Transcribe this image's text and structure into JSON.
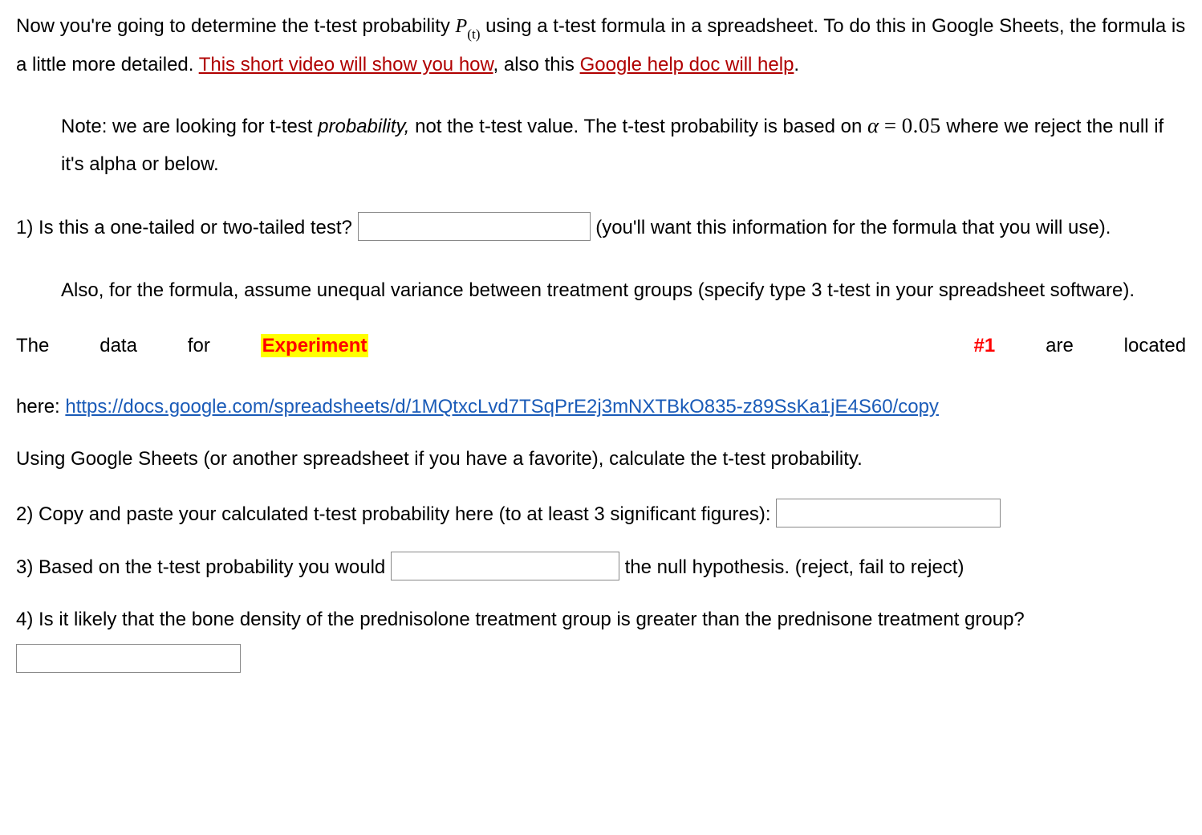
{
  "intro": {
    "part1": "Now you're going to determine the t-test probability ",
    "pt_P": "P",
    "pt_sub": "(t)",
    "part2": " using a t-test formula in a spreadsheet. To do this in Google Sheets, the formula is a little more detailed. ",
    "link1": "This short video will show  you how",
    "part3": ", also this ",
    "link2": "Google help doc will help",
    "part4": "."
  },
  "note": {
    "part1": "Note: we are looking for t-test ",
    "italic": "probability,",
    "part2": " not the t-test value. The t-test probability is based on ",
    "alpha": "α",
    "eq": " = ",
    "val": "0.05",
    "part3": " where we reject the null if it's alpha or below."
  },
  "q1": {
    "label": "1) Is this a one-tailed or two-tailed test? ",
    "after": " (you'll want this information for the formula that you will use)."
  },
  "also": "Also, for the formula, assume unequal variance between treatment groups (specify type 3 t-test in your spreadsheet software).",
  "dataline": {
    "the": "The",
    "data": "data",
    "for_": "for",
    "exp": "Experiment",
    "num": "#1",
    "are": "are",
    "located": "located",
    "here": "here: ",
    "url": "https://docs.google.com/spreadsheets/d/1MQtxcLvd7TSqPrE2j3mNXTBkO835-z89SsKa1jE4S60/copy"
  },
  "using": "Using Google Sheets (or another spreadsheet if you have a favorite), calculate the t-test probability.",
  "q2": "2) Copy and paste your calculated t-test probability here (to at least 3 significant figures): ",
  "q3": {
    "before": "3) Based on the t-test probability you would ",
    "after": " the null hypothesis. (reject, fail to reject)"
  },
  "q4": "4) Is it likely that the bone density of the prednisolone treatment group is greater than the prednisone treatment group?"
}
